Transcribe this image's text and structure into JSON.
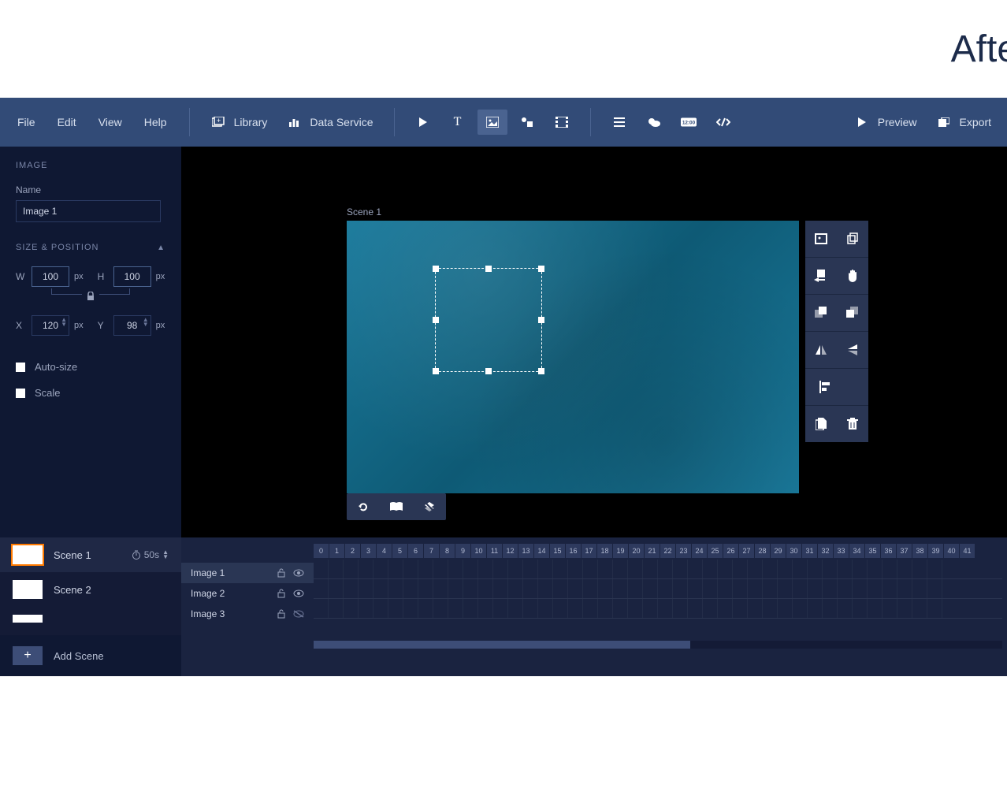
{
  "header_text": "After",
  "menus": {
    "file": "File",
    "edit": "Edit",
    "view": "View",
    "help": "Help"
  },
  "toolbar": {
    "library": "Library",
    "data_service": "Data Service",
    "preview": "Preview",
    "export": "Export"
  },
  "props": {
    "title": "IMAGE",
    "name_label": "Name",
    "name_value": "Image 1",
    "size_pos_title": "SIZE & POSITION",
    "w_label": "W",
    "w_value": "100",
    "h_label": "H",
    "h_value": "100",
    "x_label": "X",
    "x_value": "120",
    "y_label": "Y",
    "y_value": "98",
    "unit": "px",
    "autosize": "Auto-size",
    "scale": "Scale"
  },
  "canvas": {
    "scene_label": "Scene 1"
  },
  "scenes": [
    {
      "name": "Scene 1",
      "duration": "50s",
      "active": true
    },
    {
      "name": "Scene 2",
      "active": false
    }
  ],
  "add_scene": "Add Scene",
  "layers": [
    {
      "name": "Image 1",
      "locked": false,
      "visible": true,
      "active": true
    },
    {
      "name": "Image 2",
      "locked": false,
      "visible": true,
      "active": false
    },
    {
      "name": "Image 3",
      "locked": false,
      "visible": false,
      "active": false
    }
  ],
  "timeline_ticks": [
    "0",
    "1",
    "2",
    "3",
    "4",
    "5",
    "6",
    "7",
    "8",
    "9",
    "10",
    "11",
    "12",
    "13",
    "14",
    "15",
    "16",
    "17",
    "18",
    "19",
    "20",
    "21",
    "22",
    "23",
    "24",
    "25",
    "26",
    "27",
    "28",
    "29",
    "30",
    "31",
    "32",
    "33",
    "34",
    "35",
    "36",
    "37",
    "38",
    "39",
    "40",
    "41"
  ]
}
